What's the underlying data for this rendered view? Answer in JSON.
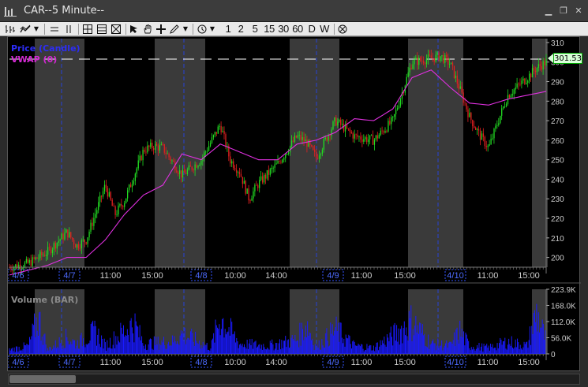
{
  "window": {
    "title": "CAR--5 Minute--",
    "icon": "chart-bars-icon"
  },
  "controls": {
    "minimize": "▁",
    "restore": "❐",
    "close": "✕"
  },
  "toolbar": {
    "intervals": [
      "1",
      "2",
      "5",
      "15",
      "30",
      "60",
      "D",
      "W"
    ],
    "icons": [
      "bar-chart-icon",
      "line-chart-icon",
      "dropdown-icon",
      "hline-icon",
      "vline-icon",
      "window-layout-1-icon",
      "window-layout-2-icon",
      "window-layout-3-icon",
      "pointer-arrow-icon",
      "hand-pan-icon",
      "crosshair-icon",
      "pencil-icon",
      "dropdown-icon",
      "clock-icon",
      "dropdown-icon",
      "no-symbol-icon"
    ]
  },
  "legend": {
    "price": "Price (Candle)",
    "vwap": "VWAP (0)",
    "volume": "Volume (BAR)"
  },
  "last_price": "301.53",
  "colors": {
    "up": "#22dd22",
    "down": "#e02020",
    "vwap": "#e030e0",
    "volume": "#1a1aff",
    "session": "#3a3a3a",
    "price_line": "#ffffff"
  },
  "chart_data": {
    "type": "candlestick",
    "price_axis": {
      "ticks": [
        "310",
        "300",
        "290",
        "280",
        "270",
        "260",
        "250",
        "240",
        "230",
        "220",
        "210",
        "200"
      ],
      "ylim": [
        195,
        312
      ]
    },
    "volume_axis": {
      "ticks": [
        "223.9K",
        "168.0K",
        "112.0K",
        "56.0K",
        "0"
      ],
      "ylim": [
        0,
        223900
      ]
    },
    "x_ticks": [
      "4/6",
      "4/7",
      "11:00",
      "15:00",
      "4/8",
      "10:00",
      "14:00",
      "4/9",
      "11:00",
      "15:00",
      "4/10",
      "11:00",
      "15:00"
    ],
    "price_path": [
      [
        0,
        195
      ],
      [
        2,
        197
      ],
      [
        4,
        203
      ],
      [
        6,
        213
      ],
      [
        7,
        206
      ],
      [
        8,
        209
      ],
      [
        10,
        237
      ],
      [
        11,
        222
      ],
      [
        12,
        229
      ],
      [
        14,
        255
      ],
      [
        15,
        257
      ],
      [
        16,
        256
      ],
      [
        18,
        242
      ],
      [
        20,
        250
      ],
      [
        22,
        268
      ],
      [
        23,
        250
      ],
      [
        24,
        244
      ],
      [
        25,
        230
      ],
      [
        26,
        238
      ],
      [
        28,
        248
      ],
      [
        30,
        262
      ],
      [
        31,
        259
      ],
      [
        32,
        251
      ],
      [
        34,
        270
      ],
      [
        36,
        262
      ],
      [
        38,
        260
      ],
      [
        40,
        270
      ],
      [
        42,
        300
      ],
      [
        44,
        302
      ],
      [
        45,
        303
      ],
      [
        46,
        299
      ],
      [
        47,
        286
      ],
      [
        48,
        272
      ],
      [
        49,
        263
      ],
      [
        50,
        256
      ],
      [
        51,
        270
      ],
      [
        52,
        283
      ],
      [
        54,
        292
      ],
      [
        55,
        297
      ],
      [
        56,
        300
      ]
    ],
    "vwap_path": [
      [
        0,
        191
      ],
      [
        4,
        196
      ],
      [
        6,
        200
      ],
      [
        8,
        200
      ],
      [
        10,
        209
      ],
      [
        12,
        222
      ],
      [
        14,
        232
      ],
      [
        16,
        237
      ],
      [
        18,
        253
      ],
      [
        20,
        250
      ],
      [
        22,
        258
      ],
      [
        24,
        254
      ],
      [
        26,
        250
      ],
      [
        28,
        250
      ],
      [
        30,
        258
      ],
      [
        32,
        260
      ],
      [
        34,
        264
      ],
      [
        36,
        271
      ],
      [
        38,
        270
      ],
      [
        40,
        276
      ],
      [
        42,
        292
      ],
      [
        44,
        296
      ],
      [
        46,
        287
      ],
      [
        48,
        279
      ],
      [
        50,
        278
      ],
      [
        52,
        281
      ],
      [
        54,
        283
      ],
      [
        56,
        285
      ]
    ],
    "volume_profile": [
      [
        0,
        20
      ],
      [
        2,
        40
      ],
      [
        3,
        180
      ],
      [
        4,
        20
      ],
      [
        6,
        80
      ],
      [
        7,
        50
      ],
      [
        9,
        110
      ],
      [
        10,
        40
      ],
      [
        13,
        150
      ],
      [
        14,
        50
      ],
      [
        17,
        60
      ],
      [
        18,
        100
      ],
      [
        21,
        30
      ],
      [
        22,
        180
      ],
      [
        24,
        50
      ],
      [
        27,
        40
      ],
      [
        30,
        70
      ],
      [
        31,
        150
      ],
      [
        32,
        30
      ],
      [
        34,
        120
      ],
      [
        36,
        40
      ],
      [
        38,
        30
      ],
      [
        40,
        90
      ],
      [
        42,
        160
      ],
      [
        44,
        50
      ],
      [
        46,
        40
      ],
      [
        47,
        110
      ],
      [
        48,
        40
      ],
      [
        50,
        30
      ],
      [
        52,
        60
      ],
      [
        54,
        40
      ],
      [
        55,
        200
      ],
      [
        56,
        60
      ]
    ]
  }
}
